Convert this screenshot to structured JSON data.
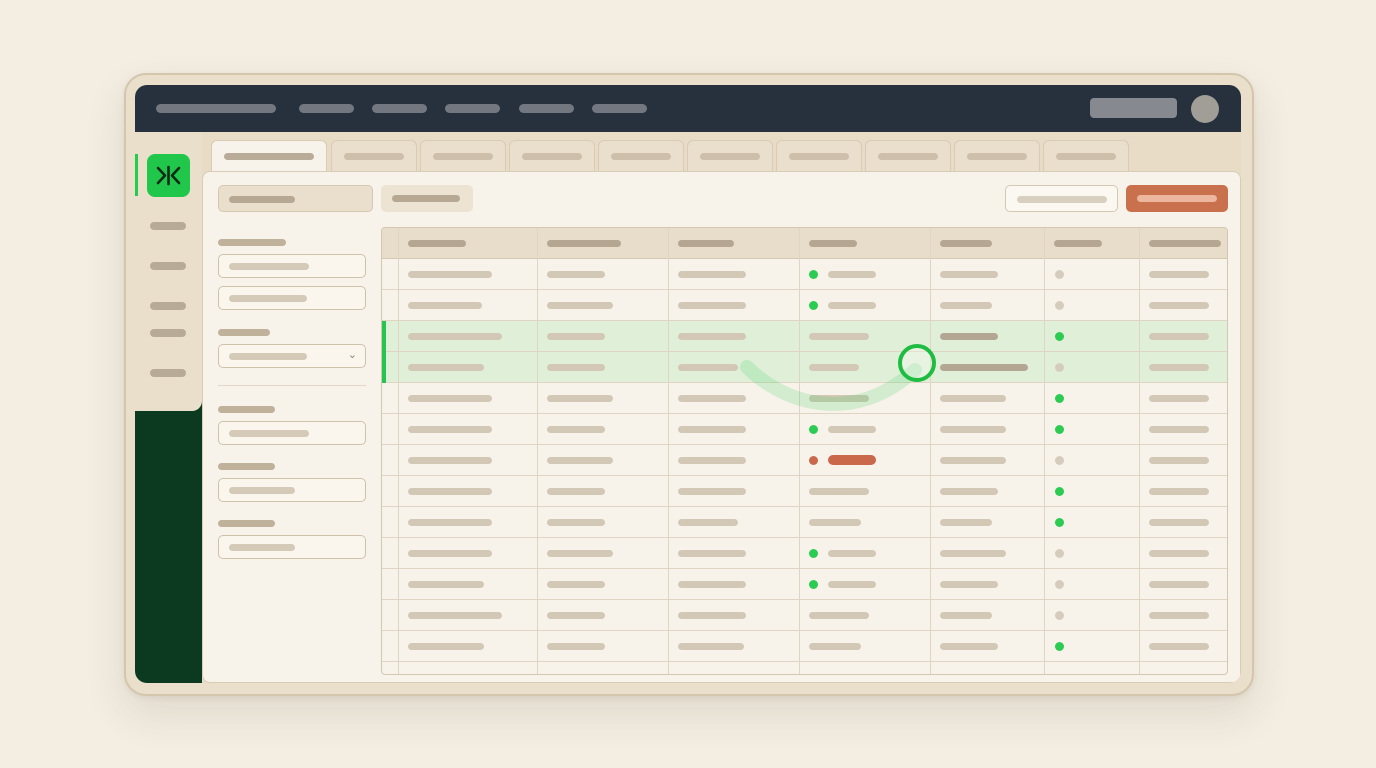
{
  "colors": {
    "topbar": "#27313e",
    "sidebar": "#0b3a21",
    "brand_green": "#21c74b",
    "primary_button": "#c9714d",
    "alert": "#c9684a",
    "status_ok": "#2ccb52",
    "status_idle": "#d6ccbd",
    "background": "#f3ede2",
    "content": "#f8f3ea"
  },
  "icons": {
    "logo": "collapse-arrows-icon",
    "dropdown": "chevron-down-icon",
    "cursor": "click-cursor-icon"
  },
  "brand": {
    "logo_glyph": "⟩|⟨"
  },
  "select": {
    "chevron": "⌄"
  },
  "table": {
    "column_count": 7,
    "highlighted_rows": [
      3,
      4
    ],
    "row_status": [
      [
        "green",
        "grey"
      ],
      [
        "green",
        "grey"
      ],
      [
        "none",
        "green"
      ],
      [
        "none",
        "grey"
      ],
      [
        "none",
        "green"
      ],
      [
        "green",
        "green"
      ],
      [
        "red",
        "grey"
      ],
      [
        "none",
        "green"
      ],
      [
        "none",
        "green"
      ],
      [
        "green",
        "grey"
      ],
      [
        "green",
        "grey"
      ],
      [
        "none",
        "grey"
      ],
      [
        "none",
        "green"
      ]
    ]
  }
}
